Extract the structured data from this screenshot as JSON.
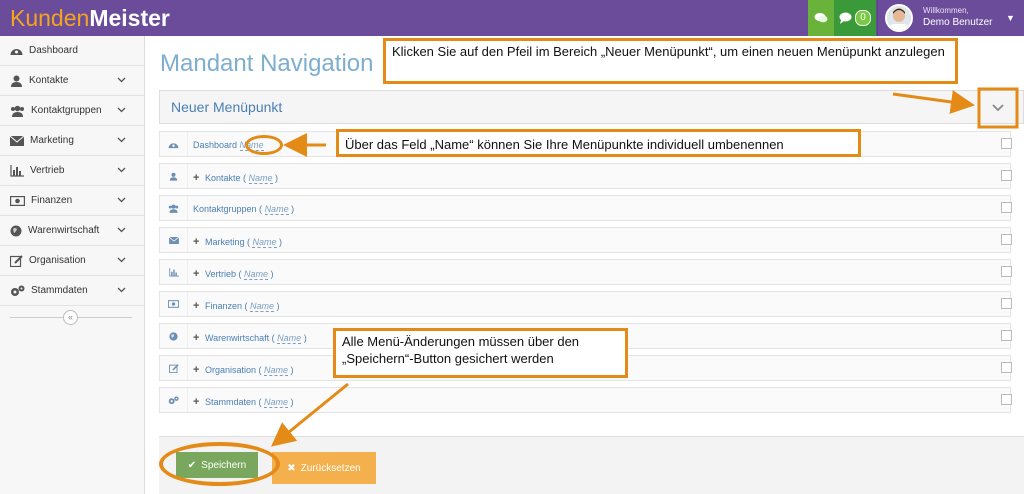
{
  "app": {
    "logo_part1": "Kunden",
    "logo_part2": "Meister"
  },
  "topbar": {
    "notification_count": "0",
    "welcome": "Willkommen,",
    "user_name": "Demo Benutzer"
  },
  "sidebar": {
    "items": [
      {
        "label": "Dashboard",
        "icon": "dashboard-icon"
      },
      {
        "label": "Kontakte",
        "icon": "user-icon"
      },
      {
        "label": "Kontaktgruppen",
        "icon": "users-icon"
      },
      {
        "label": "Marketing",
        "icon": "envelope-icon"
      },
      {
        "label": "Vertrieb",
        "icon": "bar-chart-icon"
      },
      {
        "label": "Finanzen",
        "icon": "money-icon"
      },
      {
        "label": "Warenwirtschaft",
        "icon": "globe-icon"
      },
      {
        "label": "Organisation",
        "icon": "edit-icon"
      },
      {
        "label": "Stammdaten",
        "icon": "cogs-icon"
      }
    ],
    "collapse_glyph": "«"
  },
  "main": {
    "title": "Mandant Navigation",
    "new_item_label": "Neuer Menüpunkt",
    "rows": [
      {
        "label": "Dashboard",
        "name_placeholder": "Name",
        "icon": "dashboard-icon",
        "has_plus": false
      },
      {
        "label": "Kontakte (",
        "name_placeholder": "Name",
        "suffix": ")",
        "icon": "user-icon",
        "has_plus": true
      },
      {
        "label": "Kontaktgruppen (",
        "name_placeholder": "Name",
        "suffix": ")",
        "icon": "users-icon",
        "has_plus": false
      },
      {
        "label": "Marketing (",
        "name_placeholder": "Name",
        "suffix": ")",
        "icon": "envelope-icon",
        "has_plus": true
      },
      {
        "label": "Vertrieb (",
        "name_placeholder": "Name",
        "suffix": ")",
        "icon": "bar-chart-icon",
        "has_plus": true
      },
      {
        "label": "Finanzen (",
        "name_placeholder": "Name",
        "suffix": ")",
        "icon": "money-icon",
        "has_plus": true
      },
      {
        "label": "Warenwirtschaft (",
        "name_placeholder": "Name",
        "suffix": ")",
        "icon": "globe-icon",
        "has_plus": true
      },
      {
        "label": "Organisation (",
        "name_placeholder": "Name",
        "suffix": ")",
        "icon": "edit-icon",
        "has_plus": true
      },
      {
        "label": "Stammdaten (",
        "name_placeholder": "Name",
        "suffix": ")",
        "icon": "cogs-icon",
        "has_plus": true
      }
    ],
    "save_label": "Speichern",
    "reset_label": "Zurücksetzen"
  },
  "callouts": {
    "arrow_hint": "Klicken Sie auf den Pfeil im Bereich „Neuer Menüpunkt“, um einen neuen Menüpunkt anzulegen",
    "name_hint": "Über das Feld „Name“ können Sie Ihre Menüpunkte individuell umbenennen",
    "save_hint": "Alle Menü-Änderungen müssen über den „Speichern“-Button gesichert werden"
  },
  "colors": {
    "topbar": "#6a4c9b",
    "accent_orange": "#e48a16",
    "save_green": "#79a75e",
    "reset_orange": "#f3b04c",
    "title_blue": "#7eaecf"
  }
}
